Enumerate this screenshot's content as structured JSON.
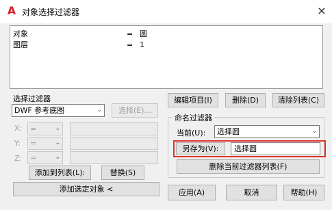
{
  "window": {
    "title": "对象选择过滤器",
    "close_glyph": "×"
  },
  "filter_list": {
    "rows": [
      {
        "left": "对象",
        "op": "=",
        "right": "圆"
      },
      {
        "left": "图层",
        "op": "=",
        "right": "1"
      }
    ]
  },
  "select_filter": {
    "label": "选择过滤器",
    "type_value": "DWF 参考底图",
    "select_button": "选择(E)...",
    "x_label": "X:",
    "y_label": "Y:",
    "z_label": "Z:",
    "op_value": "=",
    "add_to_list": "添加到列表(L):",
    "replace": "替换(S)",
    "add_selected": "添加选定对象 <"
  },
  "list_buttons": {
    "edit": "编辑项目(I)",
    "delete": "删除(D)",
    "clear": "清除列表(C)"
  },
  "named_filters": {
    "label": "命名过滤器",
    "current_label": "当前(U):",
    "current_value": "选择圆",
    "save_as_label": "另存为(V):",
    "save_as_value": "选择圆",
    "delete_current": "删除当前过滤器列表(F)"
  },
  "footer": {
    "apply": "应用(A)",
    "cancel": "取消",
    "help": "帮助(H)"
  }
}
